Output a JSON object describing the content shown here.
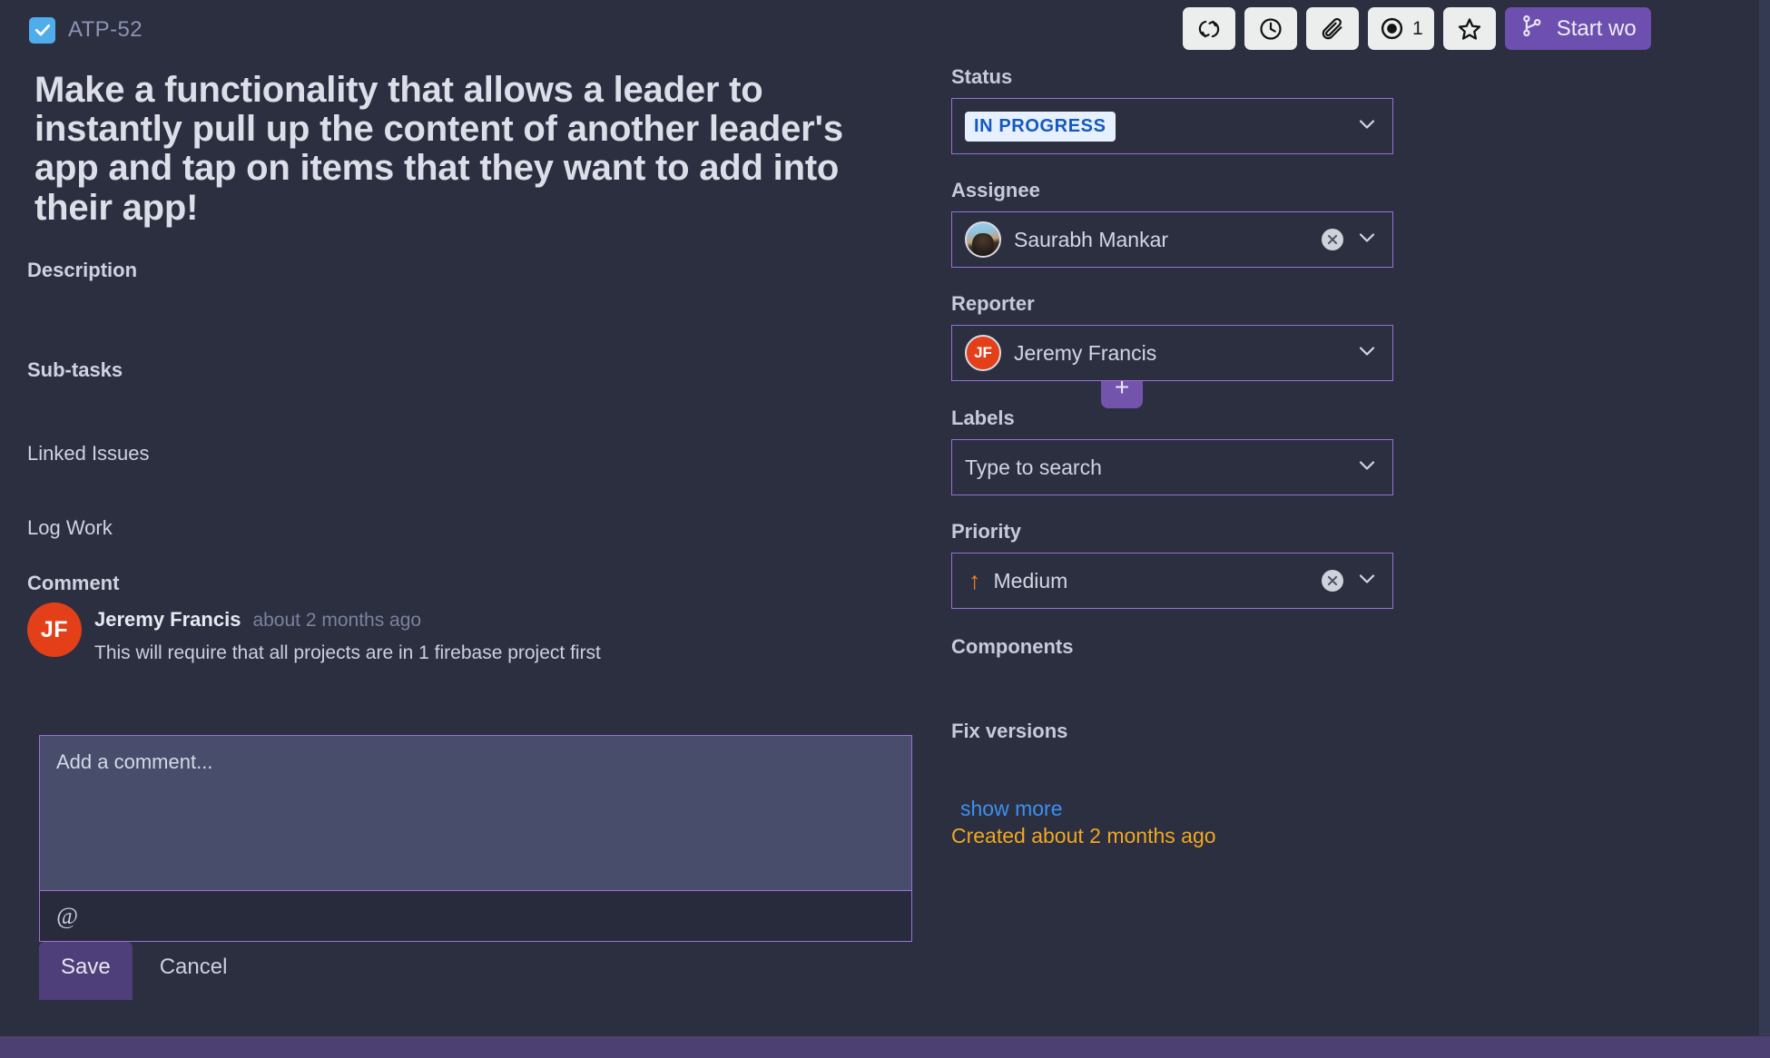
{
  "issue": {
    "key": "ATP-52",
    "type_icon": "task-checkbox-icon",
    "title": "Make a functionality that allows a leader to instantly pull up the content of another leader's app and tap on items that they want to add into their app!"
  },
  "toolbar": {
    "buttons": [
      {
        "name": "refresh-icon",
        "label": ""
      },
      {
        "name": "clock-icon",
        "label": ""
      },
      {
        "name": "paperclip-icon",
        "label": ""
      },
      {
        "name": "watch-eye-icon",
        "label": "1"
      },
      {
        "name": "star-icon",
        "label": ""
      }
    ],
    "watch_count": "1",
    "start_work_label": "Start wo"
  },
  "sections": {
    "description": "Description",
    "subtasks": "Sub-tasks",
    "linked_issues": "Linked Issues",
    "log_work": "Log Work",
    "comment": "Comment",
    "add_subtask_label": "+",
    "add_link_label": "+"
  },
  "comment": {
    "author": "Jeremy Francis",
    "author_initials": "JF",
    "time": "about 2 months ago",
    "text": "This will require that all projects are in 1 firebase project first",
    "placeholder": "Add a comment...",
    "mention_symbol": "@",
    "save_label": "Save",
    "cancel_label": "Cancel"
  },
  "sidebar": {
    "status": {
      "label": "Status",
      "value": "IN PROGRESS",
      "badge_bg": "#e6f0fe",
      "badge_fg": "#1558c0"
    },
    "assignee": {
      "label": "Assignee",
      "value": "Saurabh Mankar"
    },
    "reporter": {
      "label": "Reporter",
      "value": "Jeremy Francis",
      "initials": "JF",
      "avatar_bg": "#e33f18"
    },
    "labels": {
      "label": "Labels",
      "placeholder": "Type to search"
    },
    "priority": {
      "label": "Priority",
      "value": "Medium",
      "arrow": "↑",
      "arrow_color": "#f58320"
    },
    "components": {
      "label": "Components"
    },
    "fix_versions": {
      "label": "Fix versions"
    },
    "show_more": "show more",
    "created": "Created about 2 months ago"
  },
  "colors": {
    "background": "#2b2f40",
    "accent_purple": "#7354ad",
    "field_border": "#9b6fd8",
    "link_blue": "#3d90f0",
    "created_orange": "#f0a81e"
  }
}
